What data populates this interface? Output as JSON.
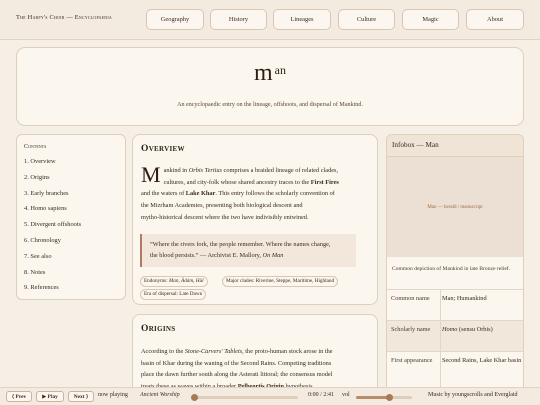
{
  "header": {
    "site_title": "The Harpy's Choir — Encyclopaedia",
    "nav": [
      "Geography",
      "History",
      "Lineages",
      "Culture",
      "Magic",
      "About"
    ]
  },
  "hero": {
    "title": "m",
    "title_sup": "an",
    "subtitle": "An encyclopaedic entry on the lineage, offshoots, and dispersal of Mankind."
  },
  "toc": {
    "title": "Contents",
    "items": [
      "1. Overview",
      "2. Origins",
      "3. Early branches",
      "4. Homo sapiens",
      "5. Divergent offshoots",
      "6. Chronology",
      "7. See also",
      "8. Notes",
      "9. References"
    ]
  },
  "overview": {
    "heading": "Overview",
    "dropcap": "M",
    "line1_a": "ankind in ",
    "line1_b": "Orbis Tertius",
    "line1_c": " comprises a braided lineage of related clades,",
    "line2_a": "cultures, and city-folk whose shared ancestry traces to the ",
    "line2_b": "First Fires",
    "line3_a": "and the waters of ",
    "line3_b": "Lake Khar",
    "line3_c": ". This entry follows the scholarly convention of",
    "line4": "the Mizrham Academies, presenting both biological descent and",
    "line5": "mytho-historical descent where the two have indivisibly entwined.",
    "quote_line1": "“Where the rivers fork, the people remember. Where the names change,",
    "quote_line2_a": "the blood persists.” — Archivist E. Mallory, ",
    "quote_line2_b": "On Man",
    "tags": {
      "endonyms_label": "Endonyms: ",
      "endonyms_value": "Man, Ádám, Hūl",
      "clades": "Major clades: Riverine, Steppe, Maritime, Highland",
      "era": "Era of dispersal: Late Dawn"
    }
  },
  "origins": {
    "heading": "Origins",
    "line1_a": "According to the ",
    "line1_b": "Stone-Carvers' Tablets",
    "line1_c": ", the proto-human stock arose in the",
    "line2": "basin of Khar during the waning of the Second Rains. Competing traditions",
    "line3": "place the dawn further south along the Asterati littoral; the consensus model",
    "line4_a": "treats these as waves within a broader ",
    "line4_b": "Pelbeortis Origin",
    "line4_c": " hypothesis."
  },
  "infobox": {
    "title": "Infobox — Man",
    "image_label": "Man — herald / manuscript",
    "caption": "Common depiction of Mankind in late Bronze relief.",
    "rows": [
      {
        "key": "Common name",
        "value": "Man; Humankind"
      },
      {
        "key": "Scholarly name",
        "value_italic": "Homo",
        "value_rest": " (sensu Orbis)"
      },
      {
        "key": "First appearance",
        "value": "Second Rains, Lake Khar basin"
      }
    ]
  },
  "player": {
    "prev": "⟨ Prev",
    "play": "▶ Play",
    "next": "Next ⟩",
    "now_playing_label": "now playing",
    "track": "Ancient Worship",
    "time": "0:00 / 2:41",
    "vol_label": "vol",
    "progress": 0.0,
    "volume": 0.6,
    "credit": "Music by youngscrolls and Everglaid"
  }
}
